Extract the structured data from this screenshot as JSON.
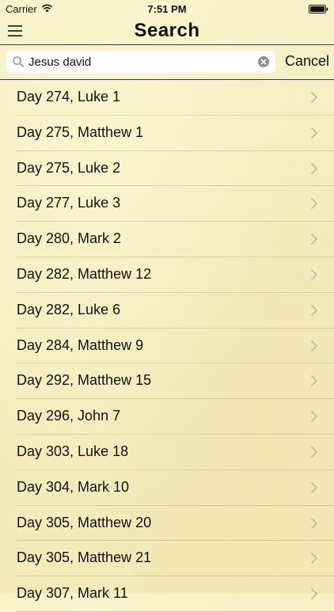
{
  "status_bar": {
    "carrier": "Carrier",
    "time": "7:51 PM"
  },
  "nav": {
    "title": "Search",
    "menu_icon": "hamburger-menu-icon"
  },
  "search": {
    "value": "Jesus david",
    "placeholder": "",
    "cancel_label": "Cancel",
    "search_icon": "magnifier-icon",
    "clear_icon": "clear-circle-icon"
  },
  "results": [
    {
      "label": "Day 274, Luke 1"
    },
    {
      "label": "Day 275, Matthew 1"
    },
    {
      "label": "Day 275, Luke 2"
    },
    {
      "label": "Day 277, Luke 3"
    },
    {
      "label": "Day 280, Mark 2"
    },
    {
      "label": "Day 282, Matthew 12"
    },
    {
      "label": "Day 282, Luke 6"
    },
    {
      "label": "Day 284, Matthew 9"
    },
    {
      "label": "Day 292, Matthew 15"
    },
    {
      "label": "Day 296, John 7"
    },
    {
      "label": "Day 303, Luke 18"
    },
    {
      "label": "Day 304, Mark 10"
    },
    {
      "label": "Day 305, Matthew 20"
    },
    {
      "label": "Day 305, Matthew 21"
    },
    {
      "label": "Day 307, Mark 11"
    }
  ]
}
